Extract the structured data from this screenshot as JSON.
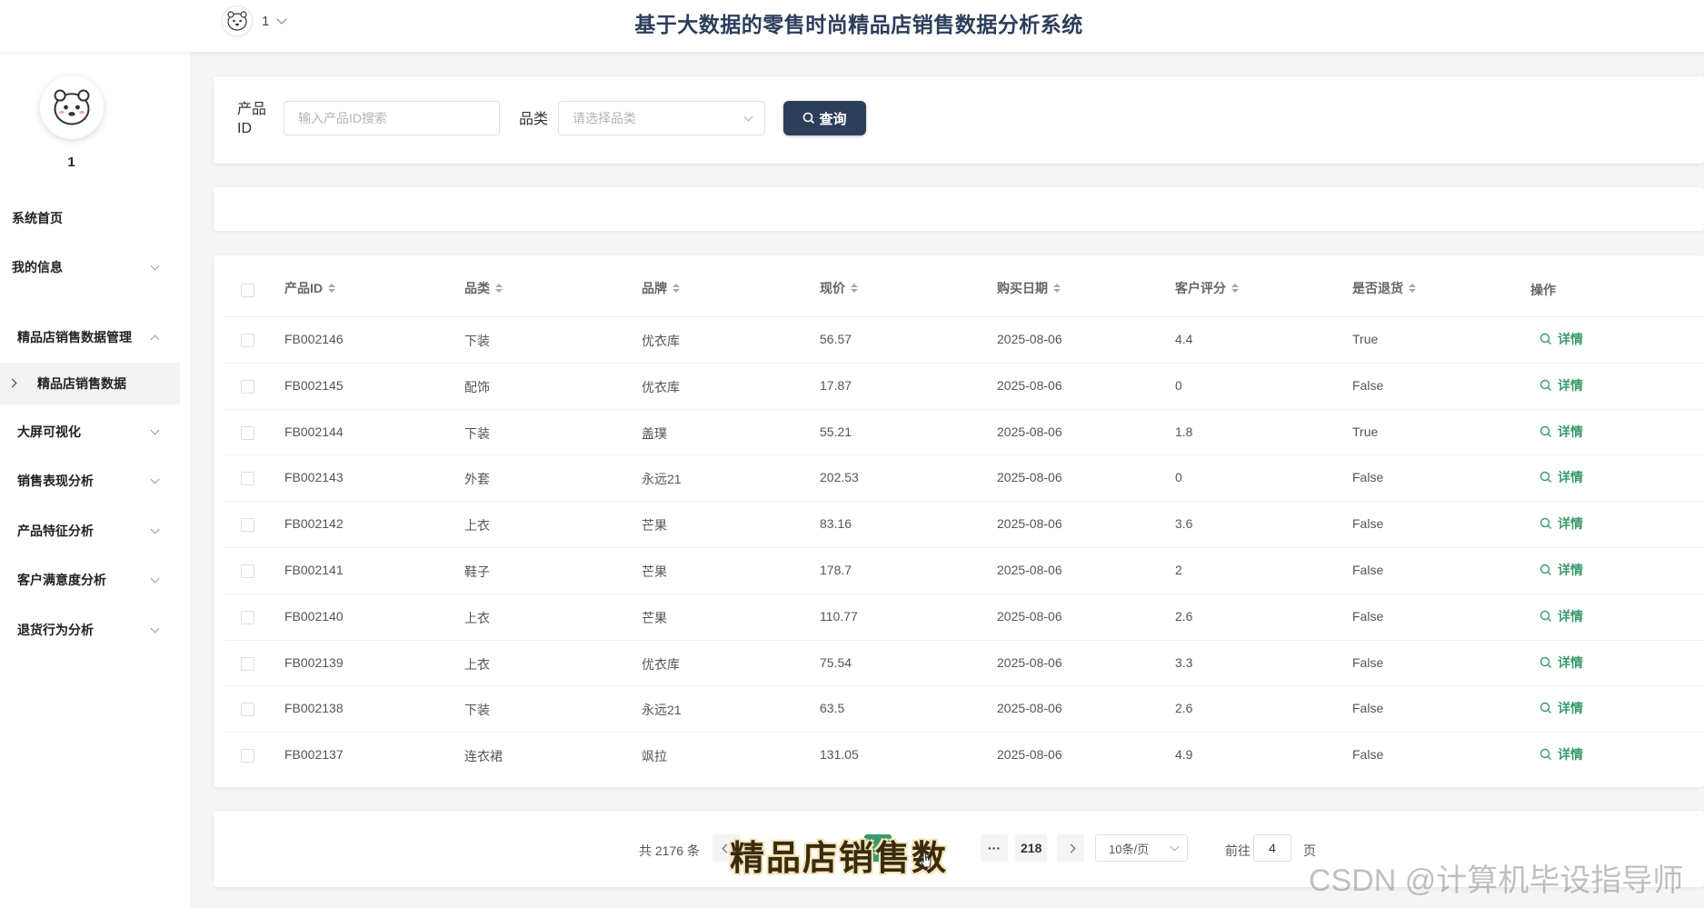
{
  "header": {
    "title": "基于大数据的零售时尚精品店销售数据分析系统",
    "username": "1"
  },
  "sidebar": {
    "username": "1",
    "items": [
      {
        "label": "系统首页"
      },
      {
        "label": "我的信息"
      },
      {
        "label": "精品店销售数据管理"
      },
      {
        "label": "精品店销售数据"
      },
      {
        "label": "大屏可视化"
      },
      {
        "label": "销售表现分析"
      },
      {
        "label": "产品特征分析"
      },
      {
        "label": "客户满意度分析"
      },
      {
        "label": "退货行为分析"
      }
    ]
  },
  "search": {
    "product_id_label": "产品ID",
    "product_id_placeholder": "输入产品ID搜索",
    "category_label": "品类",
    "category_placeholder": "请选择品类",
    "query_label": "查询"
  },
  "table": {
    "columns": [
      "产品ID",
      "品类",
      "品牌",
      "现价",
      "购买日期",
      "客户评分",
      "是否退货",
      "操作"
    ],
    "action_label": "详情",
    "rows": [
      [
        "FB002146",
        "下装",
        "优衣库",
        "56.57",
        "2025-08-06",
        "4.4",
        "True"
      ],
      [
        "FB002145",
        "配饰",
        "优衣库",
        "17.87",
        "2025-08-06",
        "0",
        "False"
      ],
      [
        "FB002144",
        "下装",
        "盖璞",
        "55.21",
        "2025-08-06",
        "1.8",
        "True"
      ],
      [
        "FB002143",
        "外套",
        "永远21",
        "202.53",
        "2025-08-06",
        "0",
        "False"
      ],
      [
        "FB002142",
        "上衣",
        "芒果",
        "83.16",
        "2025-08-06",
        "3.6",
        "False"
      ],
      [
        "FB002141",
        "鞋子",
        "芒果",
        "178.7",
        "2025-08-06",
        "2",
        "False"
      ],
      [
        "FB002140",
        "上衣",
        "芒果",
        "110.77",
        "2025-08-06",
        "2.6",
        "False"
      ],
      [
        "FB002139",
        "上衣",
        "优衣库",
        "75.54",
        "2025-08-06",
        "3.3",
        "False"
      ],
      [
        "FB002138",
        "下装",
        "永远21",
        "63.5",
        "2025-08-06",
        "2.6",
        "False"
      ],
      [
        "FB002137",
        "连衣裙",
        "飒拉",
        "131.05",
        "2025-08-06",
        "4.9",
        "False"
      ]
    ]
  },
  "pagination": {
    "total": "共 2176 条",
    "ellipsis": "···",
    "last_page": "218",
    "page_size": "10条/页",
    "goto_label": "前往",
    "goto_value": "4",
    "page_unit": "页"
  },
  "overlay": {
    "caption": "精品店销售数",
    "watermark": "CSDN @计算机毕设指导师"
  },
  "colors": {
    "primary": "#2d3e5a",
    "accent": "#3a9a6a"
  }
}
